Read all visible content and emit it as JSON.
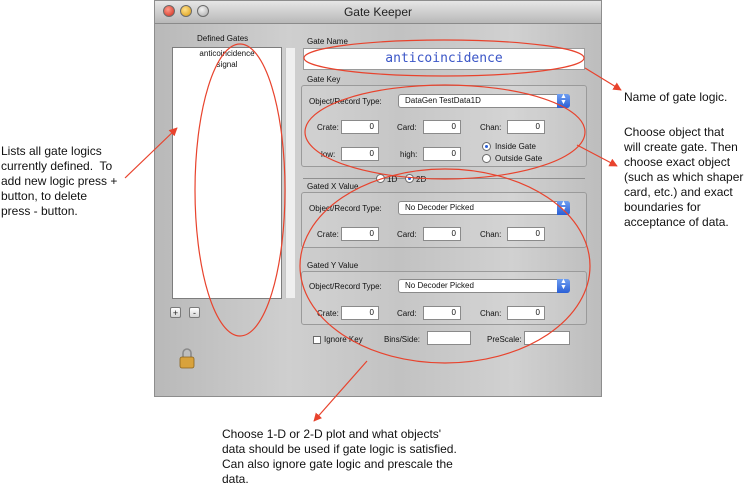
{
  "window": {
    "title": "Gate Keeper"
  },
  "gates": {
    "header": "Defined Gates",
    "items": [
      "anticoincidence",
      "signal"
    ],
    "add_label": "+",
    "remove_label": "-"
  },
  "gate_name": {
    "label": "Gate Name",
    "value": "anticoincidence"
  },
  "gate_key": {
    "label": "Gate Key",
    "object_type_label": "Object/Record Type:",
    "object_type_value": "DataGen   TestData1D",
    "crate_label": "Crate:",
    "crate_value": "0",
    "card_label": "Card:",
    "card_value": "0",
    "chan_label": "Chan:",
    "chan_value": "0",
    "low_label": "low:",
    "low_value": "0",
    "high_label": "high:",
    "high_value": "0",
    "inside_label": "Inside Gate",
    "outside_label": "Outside Gate"
  },
  "dimension": {
    "option_1d": "1D",
    "option_2d": "2D"
  },
  "gated_x": {
    "label": "Gated X Value",
    "object_type_label": "Object/Record Type:",
    "object_type_value": "No Decoder Picked",
    "crate_label": "Crate:",
    "crate_value": "0",
    "card_label": "Card:",
    "card_value": "0",
    "chan_label": "Chan:",
    "chan_value": "0"
  },
  "gated_y": {
    "label": "Gated Y Value",
    "object_type_label": "Object/Record Type:",
    "object_type_value": "No Decoder Picked",
    "crate_label": "Crate:",
    "crate_value": "0",
    "card_label": "Card:",
    "card_value": "0",
    "chan_label": "Chan:",
    "chan_value": "0"
  },
  "options": {
    "ignore_key_label": "Ignore Key",
    "bins_label": "Bins/Side:",
    "bins_value": "",
    "prescale_label": "PreScale:",
    "prescale_value": ""
  },
  "annotations": {
    "name": "Name of gate logic.",
    "object": "Choose object that\nwill create gate. Then\nchoose exact object\n(such as which shaper\ncard, etc.) and exact\nboundaries for\nacceptance of data.",
    "list": "Lists all gate logics\ncurrently defined.  To\nadd new logic press +\nbutton, to delete\npress - button.",
    "plot": "Choose 1-D or 2-D plot and what objects'\ndata should be used if gate logic is satisfied.\nCan also ignore gate logic and prescale the\ndata."
  },
  "colors": {
    "annotation": "#e8432d",
    "field_text": "#3b56c7",
    "popup_arrow": "#2a5fd6"
  }
}
